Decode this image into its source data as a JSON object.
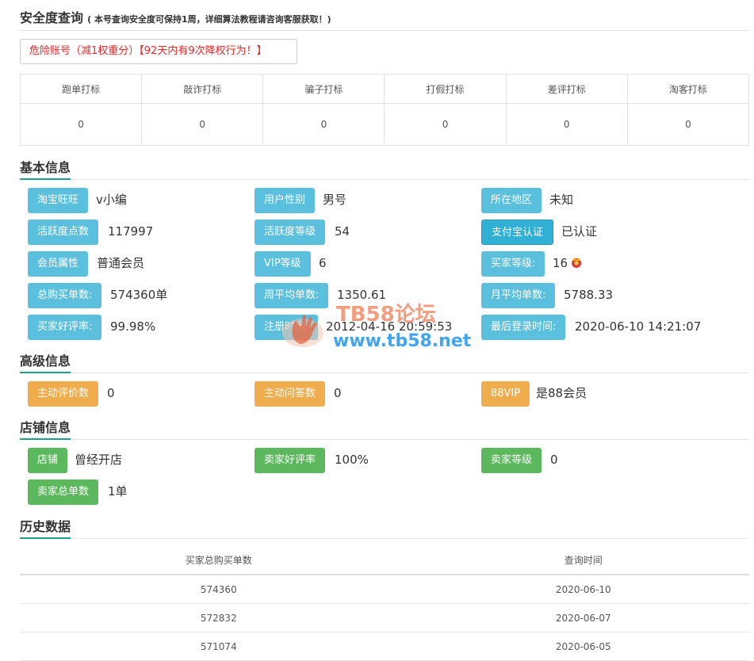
{
  "security": {
    "title": "安全度查询",
    "note": "( 本号查询安全度可保持1周，详细算法教程请咨询客服获取！)",
    "danger_text": "危险账号（减1权重分）【92天内有9次降权行为！】",
    "columns": [
      "跑单打标",
      "敲诈打标",
      "骗子打标",
      "打假打标",
      "差评打标",
      "淘客打标"
    ],
    "values": [
      "0",
      "0",
      "0",
      "0",
      "0",
      "0"
    ]
  },
  "basic": {
    "title": "基本信息",
    "wangwang_label": "淘宝旺旺",
    "wangwang_value": "v小编",
    "gender_label": "用户性别",
    "gender_value": "男号",
    "region_label": "所在地区",
    "region_value": "未知",
    "activity_label": "活跃度点数",
    "activity_value": "117997",
    "activity_level_label": "活跃度等级",
    "activity_level_value": "54",
    "alipay_label": "支付宝认证",
    "alipay_value": "已认证",
    "member_label": "会员属性",
    "member_value": "普通会员",
    "vip_label": "VIP等级",
    "vip_value": "6",
    "buyer_level_label": "买家等级:",
    "buyer_level_value": "16",
    "total_orders_label": "总购买单数:",
    "total_orders_value": "574360单",
    "weekly_label": "周平均单数:",
    "weekly_value": "1350.61",
    "monthly_label": "月平均单数:",
    "monthly_value": "5788.33",
    "rating_label": "买家好评率:",
    "rating_value": "99.98%",
    "register_label": "注册时间:",
    "register_value": "2012-04-16 20:59:53",
    "last_login_label": "最后登录时间:",
    "last_login_value": "2020-06-10 14:21:07"
  },
  "advanced": {
    "title": "高级信息",
    "review_label": "主动评价数",
    "review_value": "0",
    "qa_label": "主动问答数",
    "qa_value": "0",
    "vip88_label": "88VIP",
    "vip88_value": "是88会员"
  },
  "shop": {
    "title": "店铺信息",
    "shop_label": "店铺",
    "shop_value": "曾经开店",
    "seller_rating_label": "卖家好评率",
    "seller_rating_value": "100%",
    "seller_level_label": "卖家等级",
    "seller_level_value": "0",
    "seller_orders_label": "卖家总单数",
    "seller_orders_value": "1单"
  },
  "history": {
    "title": "历史数据",
    "col_orders": "买家总购买单数",
    "col_date": "查询时间",
    "rows": [
      {
        "orders": "574360",
        "date": "2020-06-10"
      },
      {
        "orders": "572832",
        "date": "2020-06-07"
      },
      {
        "orders": "571074",
        "date": "2020-06-05"
      }
    ]
  },
  "watermark": {
    "brand": "TB58论坛",
    "url": "www.tb58.net"
  },
  "colors": {
    "info": "#5bc0de",
    "warning": "#f0ad4e",
    "success": "#5cb85c",
    "danger": "#e8282b",
    "accent": "#1aa093"
  }
}
